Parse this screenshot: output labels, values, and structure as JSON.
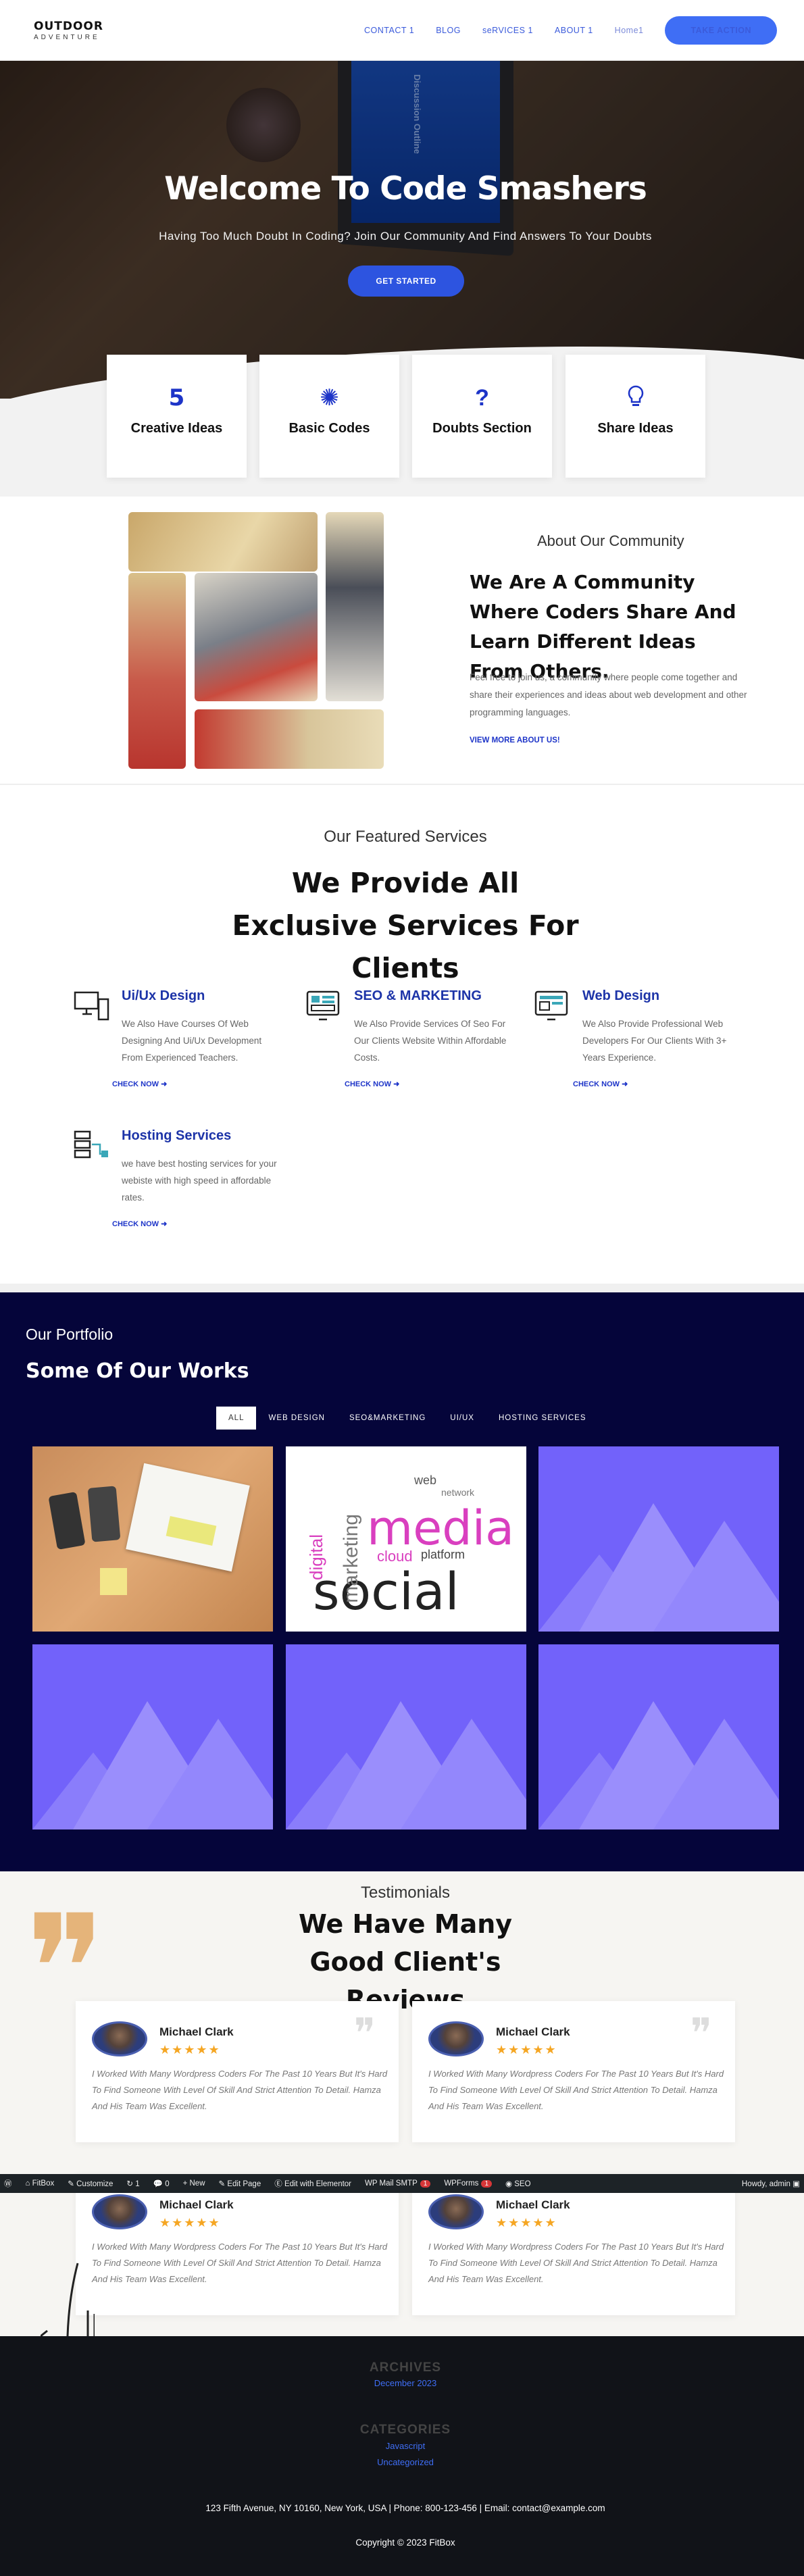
{
  "header": {
    "logo_line1": "OUTDOOR",
    "logo_line2": "ADVENTURE",
    "nav": [
      "CONTACT 1",
      "BLOG",
      "seRVICES 1",
      "ABOUT 1",
      "Home1"
    ],
    "cta": "TAKE ACTION"
  },
  "hero": {
    "title": "Welcome To Code Smashers",
    "subtitle": "Having Too Much Doubt In Coding?  Join Our Community And Find Answers To Your Doubts",
    "button": "GET STARTED",
    "screen_text": "Discussion Outline"
  },
  "features": [
    {
      "icon": "html5-icon",
      "glyph": "5",
      "label": "Creative Ideas"
    },
    {
      "icon": "bug-icon",
      "glyph": "✺",
      "label": "Basic Codes"
    },
    {
      "icon": "question-icon",
      "glyph": "?",
      "label": "Doubts Section"
    },
    {
      "icon": "lightbulb-icon",
      "glyph": "💡",
      "label": "Share Ideas"
    }
  ],
  "about": {
    "small_title": "About Our Community",
    "title": "We Are A Community Where Coders Share And Learn Different Ideas From Others.",
    "text": "Feel free to join us, a community where people come together and share their experiences and ideas about web development and other programming languages.",
    "link": "VIEW MORE ABOUT US!"
  },
  "services": {
    "small_title": "Our Featured Services",
    "title": "We Provide All Exclusive Services For Clients",
    "items": [
      {
        "icon": "desktop-icon",
        "title": "Ui/Ux Design",
        "desc": "We Also Have Courses Of Web Designing And Ui/Ux Development From Experienced Teachers.",
        "link": "CHECK NOW"
      },
      {
        "icon": "seo-monitor-icon",
        "title": "SEO & MARKETING",
        "desc": "We Also Provide Services Of Seo For Our Clients Website Within Affordable Costs.",
        "link": "CHECK NOW"
      },
      {
        "icon": "web-monitor-icon",
        "title": "Web Design",
        "desc": "We Also Provide Professional Web Developers For Our Clients With 3+ Years Experience.",
        "link": "CHECK NOW"
      },
      {
        "icon": "hosting-icon",
        "title": "Hosting Services",
        "desc": "we have best hosting services for your webiste with high speed in affordable rates.",
        "link": "CHECK NOW"
      }
    ]
  },
  "portfolio": {
    "small_title": "Our Portfolio",
    "title": "Some Of Our Works",
    "tabs": [
      "ALL",
      "WEB DESIGN",
      "SEO&MARKETING",
      "UI/UX",
      "HOSTING SERVICES"
    ],
    "active_tab": "ALL",
    "word_cloud": [
      "media",
      "social",
      "marketing",
      "digital",
      "cloud",
      "platform",
      "web",
      "network"
    ]
  },
  "testimonials": {
    "small_title": "Testimonials",
    "title": "We Have Many Good Client's Reviews",
    "reviews": [
      {
        "name": "Michael Clark",
        "stars": "★★★★★",
        "text": "I Worked With Many Wordpress Coders For The Past 10 Years But It's Hard To Find Someone With Level Of Skill And Strict Attention To Detail. Hamza And His Team Was Excellent."
      },
      {
        "name": "Michael Clark",
        "stars": "★★★★★",
        "text": "I Worked With Many Wordpress Coders For The Past 10 Years But It's Hard To Find Someone With Level Of Skill And Strict Attention To Detail. Hamza And His Team Was Excellent."
      },
      {
        "name": "Michael Clark",
        "stars": "★★★★★",
        "text": "I Worked With Many Wordpress Coders For The Past 10 Years But It's Hard To Find Someone With Level Of Skill And Strict Attention To Detail. Hamza And His Team Was Excellent."
      },
      {
        "name": "Michael Clark",
        "stars": "★★★★★",
        "text": "I Worked With Many Wordpress Coders For The Past 10 Years But It's Hard To Find Someone With Level Of Skill And Strict Attention To Detail. Hamza And His Team Was Excellent."
      }
    ]
  },
  "admin_bar": {
    "site": "FitBox",
    "customize": "Customize",
    "updates": "1",
    "comments": "0",
    "new": "+ New",
    "edit_page": "Edit Page",
    "elementor": "Edit with Elementor",
    "smtp": "WP Mail SMTP",
    "smtp_badge": "1",
    "wpforms": "WPForms",
    "wpforms_badge": "1",
    "seo": "SEO",
    "howdy": "Howdy, admin"
  },
  "footer": {
    "archives_title": "ARCHIVES",
    "archive_link": "December 2023",
    "categories_title": "CATEGORIES",
    "categories": [
      "Javascript",
      "Uncategorized"
    ],
    "address": "123 Fifth Avenue, NY 10160, New York, USA | Phone: 800-123-456 | Email: contact@example.com",
    "copyright": "Copyright © 2023 FitBox"
  },
  "colors": {
    "brand_blue": "#3f6ef5",
    "navy": "#05053a",
    "quote_tan": "#e5b47a",
    "placeholder_purple": "#7262fa"
  }
}
